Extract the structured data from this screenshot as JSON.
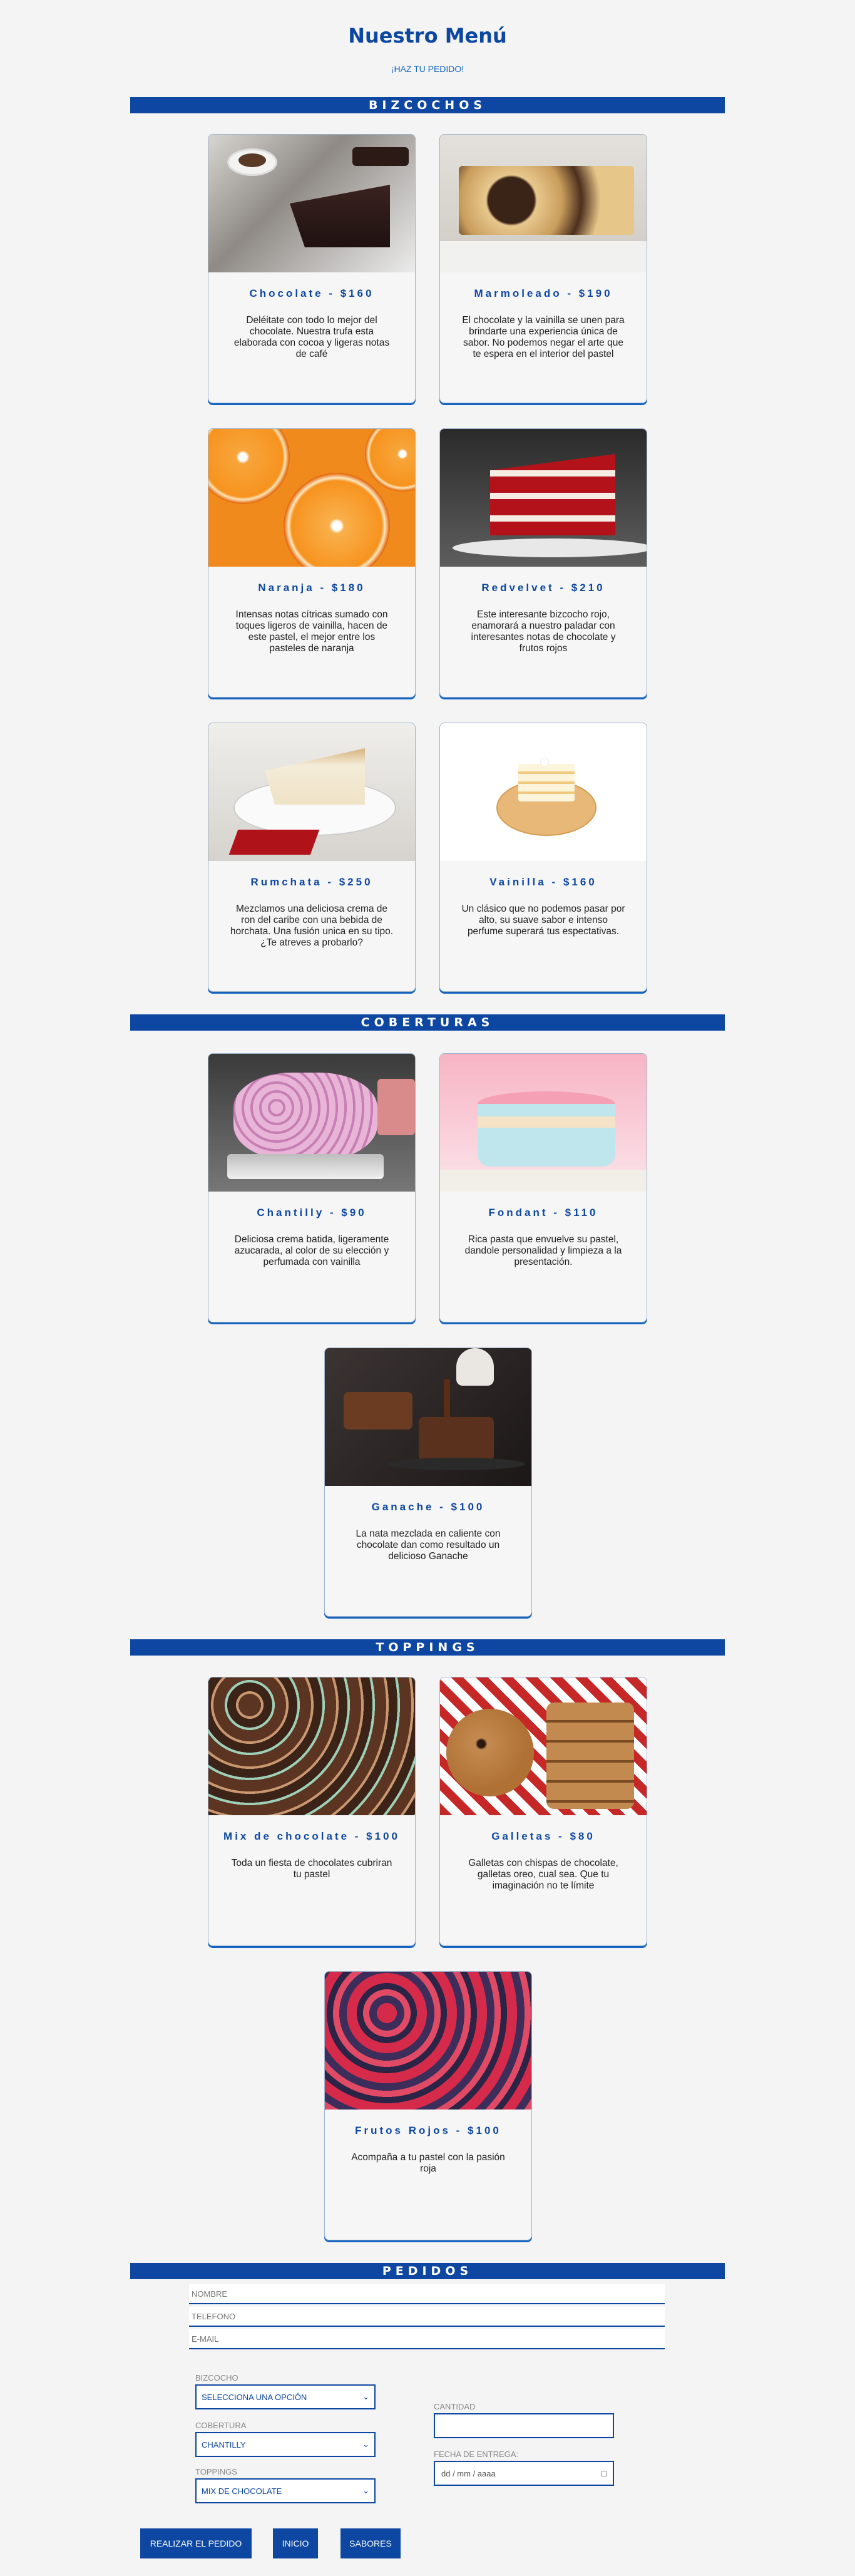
{
  "header": {
    "title": "Nuestro Menú",
    "subtitle": "¡HAZ TU PEDIDO!"
  },
  "sections": {
    "bizcochos": "BIZCOCHOS",
    "coberturas": "COBERTURAS",
    "toppings": "TOPPINGS",
    "pedidos": "PEDIDOS"
  },
  "cards": [
    {
      "title": "Chocolate - $160",
      "text": "Deléitate con todo lo mejor del chocolate. Nuestra trufa esta elaborada con cocoa y ligeras notas de café"
    },
    {
      "title": "Marmoleado - $190",
      "text": "El chocolate y la vainilla se unen para brindarte una experiencia única de sabor. No podemos negar el arte que te espera en el interior del pastel"
    },
    {
      "title": "Naranja - $180",
      "text": "Intensas notas cítricas sumado con toques ligeros de vainilla, hacen de este pastel, el mejor entre los pasteles de naranja"
    },
    {
      "title": "Redvelvet - $210",
      "text": "Este interesante bizcocho rojo, enamorará a nuestro paladar con interesantes notas de chocolate y frutos rojos"
    },
    {
      "title": "Rumchata - $250",
      "text": "Mezclamos una deliciosa crema de ron del caribe con una bebida de horchata. Una fusión unica en su tipo. ¿Te atreves a probarlo?"
    },
    {
      "title": "Vainilla - $160",
      "text": "Un clásico que no podemos pasar por alto, su suave sabor e intenso perfume superará tus espectativas."
    },
    {
      "title": "Chantilly - $90",
      "text": "Deliciosa crema batida, ligeramente azucarada, al color de su elección y perfumada con vainilla"
    },
    {
      "title": "Fondant - $110",
      "text": "Rica pasta que envuelve su pastel, dandole personalidad y limpieza a la presentación."
    },
    {
      "title": "Ganache - $100",
      "text": "La nata mezclada en caliente con chocolate dan como resultado un delicioso Ganache"
    },
    {
      "title": "Mix de chocolate - $100",
      "text": "Toda un fiesta de chocolates cubriran tu pastel"
    },
    {
      "title": "Galletas - $80",
      "text": "Galletas con chispas de chocolate, galletas oreo, cual sea. Que tu imaginación no te límite"
    },
    {
      "title": "Frutos Rojos - $100",
      "text": "Acompaña a tu pastel con la pasión roja"
    }
  ],
  "form": {
    "name_placeholder": "NOMBRE",
    "phone_placeholder": "TELEFONO",
    "email_placeholder": "E-MAIL",
    "bizcocho_label": "BIZCOCHO",
    "bizcocho_value": "SELECCIONA UNA OPCIÓN",
    "cobertura_label": "COBERTURA",
    "cobertura_value": "CHANTILLY",
    "toppings_label": "TOPPINGS",
    "toppings_value": "MIX DE CHOCOLATE",
    "cantidad_label": "CANTIDAD",
    "fecha_label": "FECHA DE ENTREGA:",
    "fecha_value": "dd / mm / aaaa"
  },
  "buttons": {
    "order": "REALIZAR EL PEDIDO",
    "home": "INICIO",
    "flavors": "SABORES"
  },
  "icons": {
    "select_arrow": "chevron-down-icon",
    "calendar": "calendar-icon"
  },
  "colors": {
    "brand": "#0d47a1",
    "background": "#f4f4f5"
  }
}
